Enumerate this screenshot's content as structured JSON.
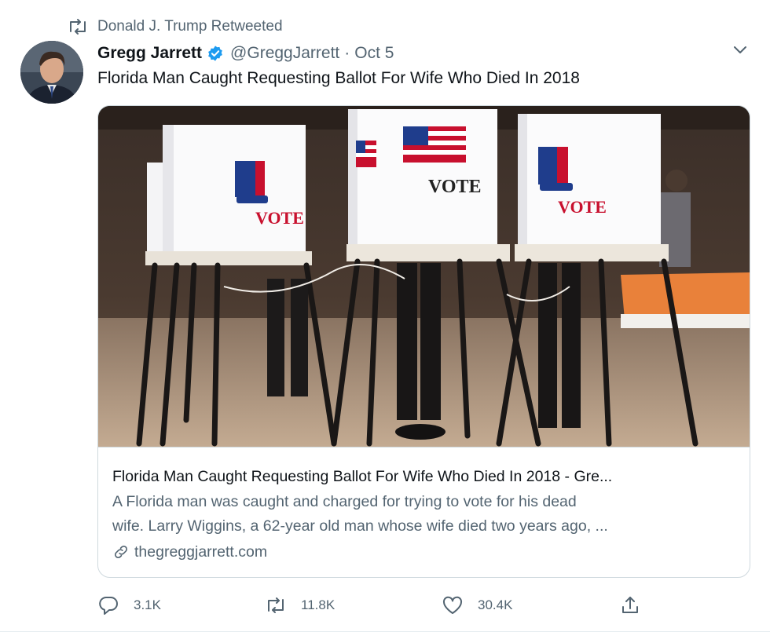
{
  "retweet_notice": {
    "text": "Donald J. Trump Retweeted",
    "icon": "retweet-icon"
  },
  "author": {
    "name": "Gregg Jarrett",
    "verified": true,
    "handle": "@GreggJarrett",
    "separator": "·",
    "date": "Oct 5",
    "avatar_icon": "avatar-photo"
  },
  "tweet": {
    "text": "Florida Man Caught Requesting Ballot For Wife Who Died In 2018"
  },
  "card": {
    "image_signs": [
      "VOTE",
      "VOTE",
      "VOTE"
    ],
    "title": "Florida Man Caught Requesting Ballot For Wife Who Died In 2018 - Gre...",
    "description_line1": "A Florida man was caught and charged for trying to vote for his dead",
    "description_line2": "wife. Larry Wiggins, a 62-year old man whose wife died two years ago, ...",
    "domain": "thegreggjarrett.com",
    "link_icon": "link-icon"
  },
  "actions": {
    "replies": "3.1K",
    "retweets": "11.8K",
    "likes": "30.4K",
    "reply_icon": "reply-icon",
    "retweet_icon": "retweet-icon",
    "like_icon": "heart-icon",
    "share_icon": "share-icon"
  },
  "colors": {
    "verified_blue": "#1d9bf0",
    "secondary_text": "#536471",
    "border": "#cfd9de"
  }
}
